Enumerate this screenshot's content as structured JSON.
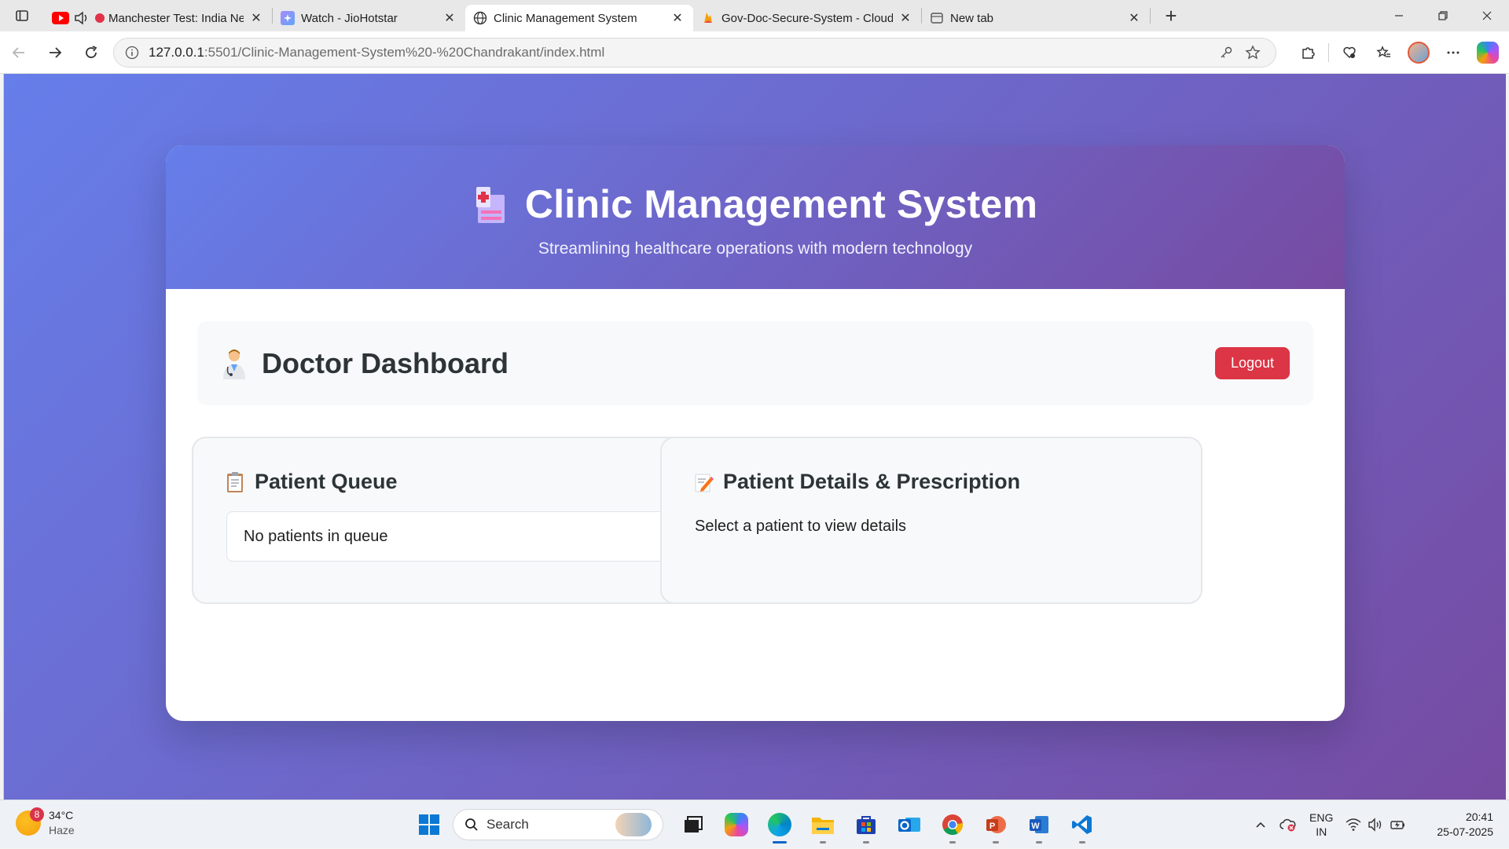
{
  "browser": {
    "tabs": [
      {
        "title": "Manchester Test: India Ne",
        "favicon": "live-record-icon",
        "active": false
      },
      {
        "title": "Watch - JioHotstar",
        "favicon": "jiohotstar-icon",
        "active": false
      },
      {
        "title": "Clinic Management System",
        "favicon": "globe-icon",
        "active": true
      },
      {
        "title": "Gov-Doc-Secure-System - Cloud",
        "favicon": "firebase-icon",
        "active": false
      },
      {
        "title": "New tab",
        "favicon": "new-tab-icon",
        "active": false
      }
    ],
    "close_glyph": "✕",
    "new_tab_glyph": "+",
    "address": {
      "host": "127.0.0.1",
      "path": ":5501/Clinic-Management-System%20-%20Chandrakant/index.html"
    }
  },
  "app": {
    "title": "Clinic Management System",
    "subtitle": "Streamlining healthcare operations with modern technology",
    "dashboard_title": "Doctor Dashboard",
    "logout_label": "Logout",
    "queue": {
      "heading": "Patient Queue",
      "empty_text": "No patients in queue"
    },
    "details": {
      "heading": "Patient Details & Prescription",
      "placeholder": "Select a patient to view details"
    },
    "colors": {
      "gradient_start": "#667eea",
      "gradient_end": "#764ba2",
      "logout": "#dc3545"
    }
  },
  "taskbar": {
    "weather": {
      "temp": "34°C",
      "condition": "Haze",
      "badge": "8"
    },
    "search_placeholder": "Search",
    "apps": [
      "task-view-icon",
      "copilot-icon",
      "edge-icon",
      "file-explorer-icon",
      "microsoft-store-icon",
      "outlook-icon",
      "chrome-icon",
      "powerpoint-icon",
      "word-icon",
      "vscode-icon"
    ],
    "language": {
      "line1": "ENG",
      "line2": "IN"
    },
    "time": "20:41",
    "date": "25-07-2025"
  }
}
